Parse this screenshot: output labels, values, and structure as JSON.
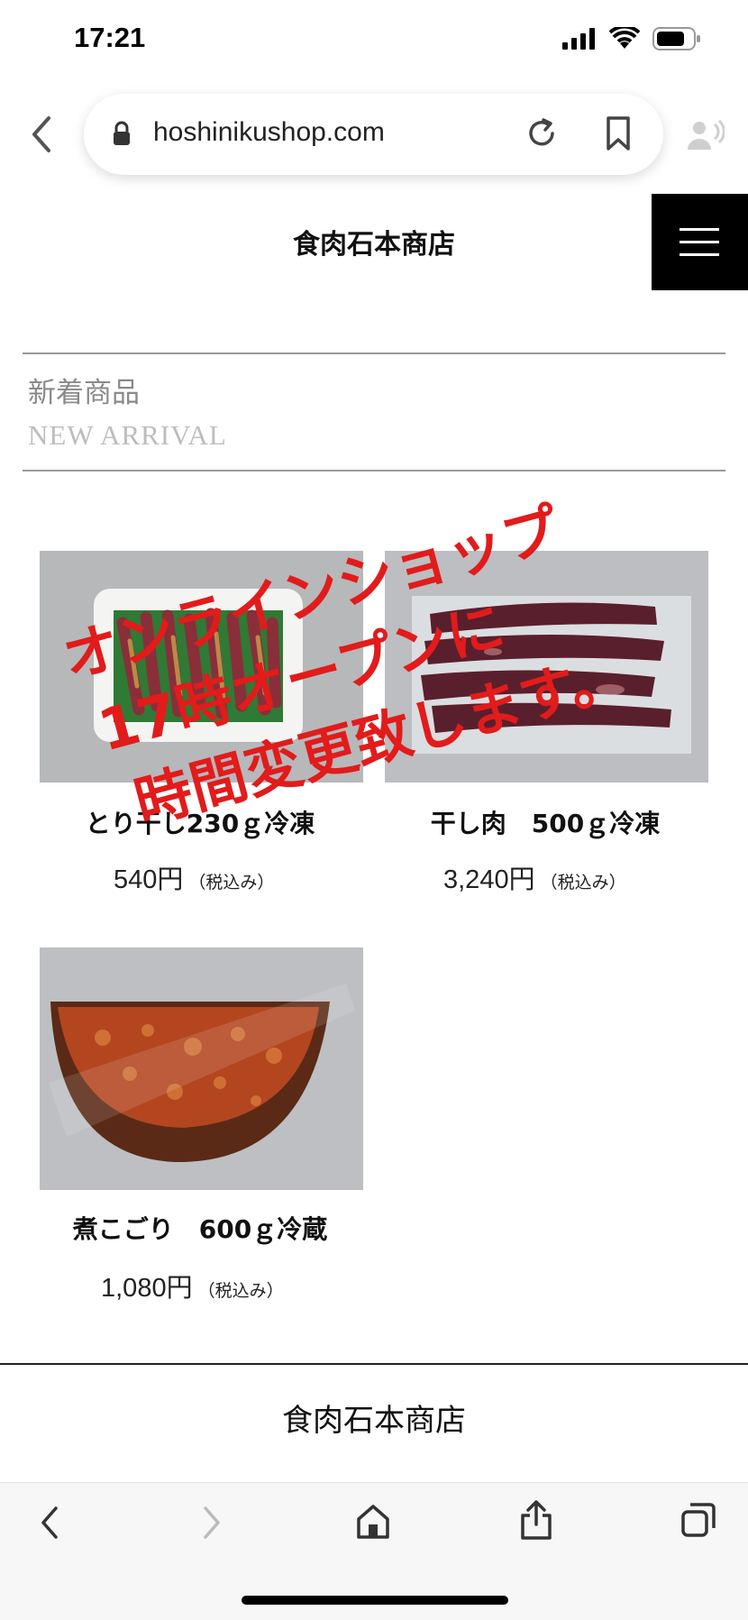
{
  "status_bar": {
    "time": "17:21"
  },
  "browser": {
    "url": "hoshinikushop.com"
  },
  "header": {
    "site_title": "食肉石本商店"
  },
  "section": {
    "title_ja": "新着商品",
    "title_en": "NEW ARRIVAL"
  },
  "products": [
    {
      "name": "とり干し230ｇ冷凍",
      "price": "540円",
      "tax_note": "（税込み）"
    },
    {
      "name": "干し肉　500ｇ冷凍",
      "price": "3,240円",
      "tax_note": "（税込み）"
    },
    {
      "name": "煮こごり　600ｇ冷蔵",
      "price": "1,080円",
      "tax_note": "（税込み）"
    }
  ],
  "notice": {
    "line1": "オンラインショップ",
    "line2": "17時オープンに",
    "line3": "時間変更致します。",
    "color": "#e21b1b"
  },
  "footer": {
    "site_title": "食肉石本商店"
  },
  "toolbar": {
    "icons": [
      "back-icon",
      "forward-icon",
      "home-icon",
      "share-icon",
      "tabs-icon"
    ]
  }
}
